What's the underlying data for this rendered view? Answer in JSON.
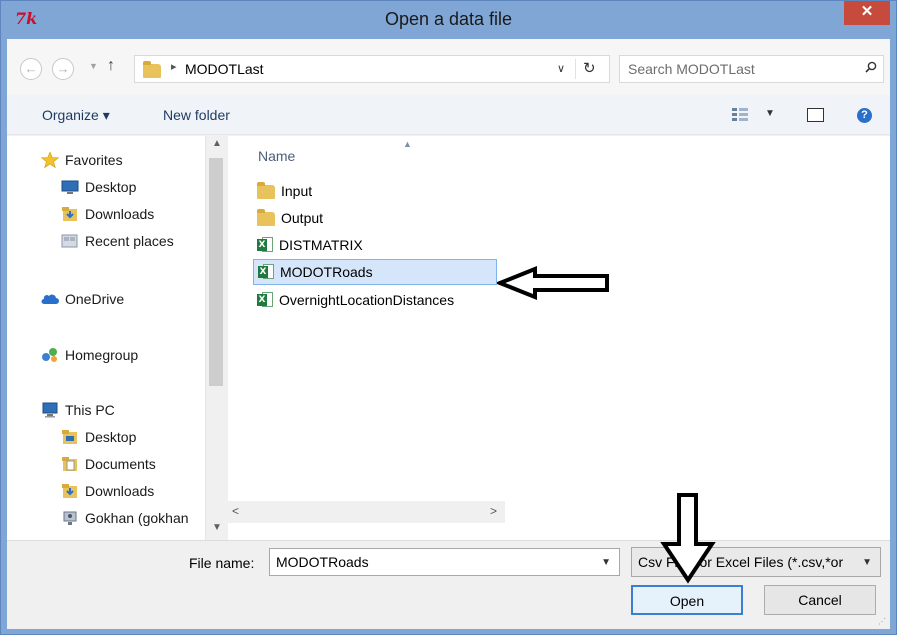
{
  "window": {
    "title": "Open a data file",
    "app_icon_text": "7k",
    "close_glyph": "✕"
  },
  "address": {
    "back_glyph": "←",
    "forward_glyph": "→",
    "up_glyph": "↑",
    "path_sep": "▸",
    "path": "MODOTLast",
    "dropdown_glyph": "∨",
    "refresh_glyph": "↻",
    "search_placeholder": "Search MODOTLast"
  },
  "toolbar": {
    "organize": "Organize ▾",
    "new_folder": "New folder",
    "help_glyph": "?"
  },
  "nav": {
    "favorites": {
      "label": "Favorites",
      "icon": "star-icon"
    },
    "favorites_items": [
      {
        "label": "Desktop",
        "icon": "desktop-icon"
      },
      {
        "label": "Downloads",
        "icon": "downloads-icon"
      },
      {
        "label": "Recent places",
        "icon": "recent-places-icon"
      }
    ],
    "onedrive": {
      "label": "OneDrive",
      "icon": "onedrive-icon"
    },
    "homegroup": {
      "label": "Homegroup",
      "icon": "homegroup-icon"
    },
    "thispc": {
      "label": "This PC",
      "icon": "computer-icon"
    },
    "thispc_items": [
      {
        "label": "Desktop",
        "icon": "desktop-folder-icon"
      },
      {
        "label": "Documents",
        "icon": "documents-icon"
      },
      {
        "label": "Downloads",
        "icon": "downloads-icon"
      },
      {
        "label": "Gokhan (gokhan",
        "icon": "network-user-icon"
      }
    ]
  },
  "files": {
    "column_header": "Name",
    "items": [
      {
        "name": "Input",
        "type": "folder"
      },
      {
        "name": "Output",
        "type": "folder"
      },
      {
        "name": "DISTMATRIX",
        "type": "excel"
      },
      {
        "name": "MODOTRoads",
        "type": "excel",
        "selected": true
      },
      {
        "name": "OvernightLocationDistances",
        "type": "excel"
      }
    ]
  },
  "bottom": {
    "file_name_label": "File name:",
    "file_name_value": "MODOTRoads",
    "filter": "Csv Files or Excel Files (*.csv,*or",
    "open": "Open",
    "cancel": "Cancel"
  },
  "colors": {
    "title_bar": "#7fa6d4",
    "close_button": "#c74b3d",
    "selection_fill": "#d5e6fa",
    "selection_border": "#7fb4ea",
    "folder": "#e8c25a",
    "excel": "#1f7a3e"
  }
}
